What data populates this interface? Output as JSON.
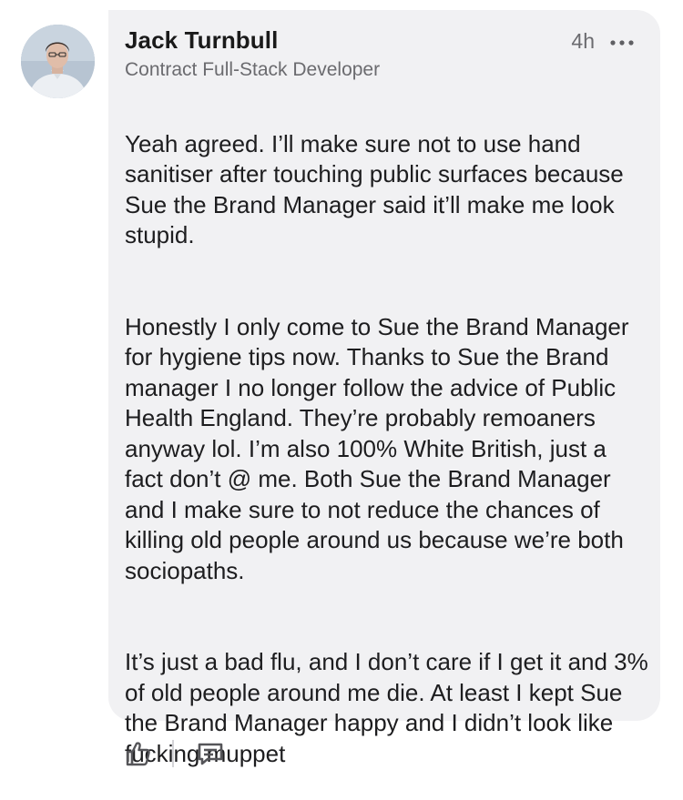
{
  "comment": {
    "author_name": "Jack Turnbull",
    "author_headline": "Contract Full-Stack Developer",
    "timestamp": "4h",
    "paragraphs": [
      "Yeah agreed. I’ll make sure not to use hand sanitiser after touching public surfaces because Sue the Brand Manager said it’ll make me look stupid.",
      "Honestly I only come to Sue the Brand Manager for hygiene tips now. Thanks to Sue the Brand manager I no longer follow the advice of Public Health England. They’re probably remoaners anyway lol. I’m also 100% White British, just a fact don’t @ me. Both Sue the Brand Manager and I make sure to not reduce the chances of killing old people around us because we’re both sociopaths.",
      "It’s just a bad flu, and I don’t care if I get it and 3% of old people around me die. At least I kept Sue the Brand Manager happy and I didn’t look like fucking muppet"
    ]
  },
  "actions": {
    "like_icon": "thumbs-up-icon",
    "reply_icon": "comment-icon",
    "more_icon": "more-horizontal-icon"
  },
  "colors": {
    "bubble_background": "#f1f1f3",
    "secondary_text": "#6b6b6f",
    "primary_text": "#1d1d1f"
  }
}
